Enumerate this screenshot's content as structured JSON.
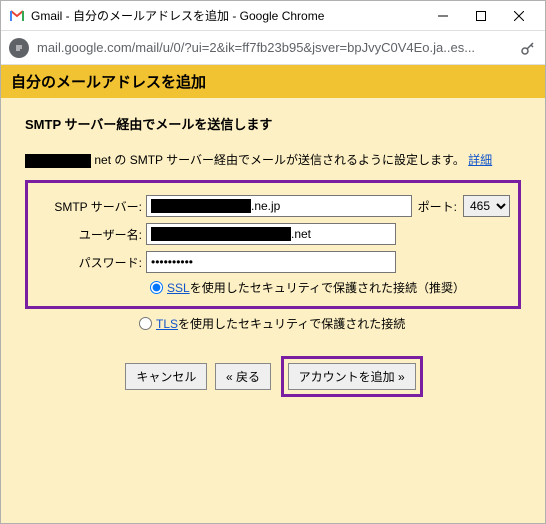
{
  "window": {
    "title": "Gmail - 自分のメールアドレスを追加 - Google Chrome"
  },
  "url": {
    "display": "mail.google.com/mail/u/0/?ui=2&ik=ff7fb23b95&jsver=bpJvyC0V4Eo.ja..es..."
  },
  "header": {
    "title": "自分のメールアドレスを追加"
  },
  "sub": {
    "title": "SMTP サーバー経由でメールを送信します"
  },
  "desc": {
    "suffix": "net の SMTP サーバー経由でメールが送信されるように設定します。",
    "detail": "詳細"
  },
  "form": {
    "smtp_label": "SMTP サーバー:",
    "smtp_suffix": ".ne.jp",
    "port_label": "ポート:",
    "port_value": "465",
    "user_label": "ユーザー名:",
    "user_suffix": ".net",
    "pass_label": "パスワード:",
    "pass_value": "••••••••••",
    "ssl_link": "SSL",
    "ssl_text": " を使用したセキュリティで保護された接続（推奨）",
    "tls_link": "TLS",
    "tls_text": " を使用したセキュリティで保護された接続"
  },
  "buttons": {
    "cancel": "キャンセル",
    "back": "« 戻る",
    "add": "アカウントを追加 »"
  }
}
